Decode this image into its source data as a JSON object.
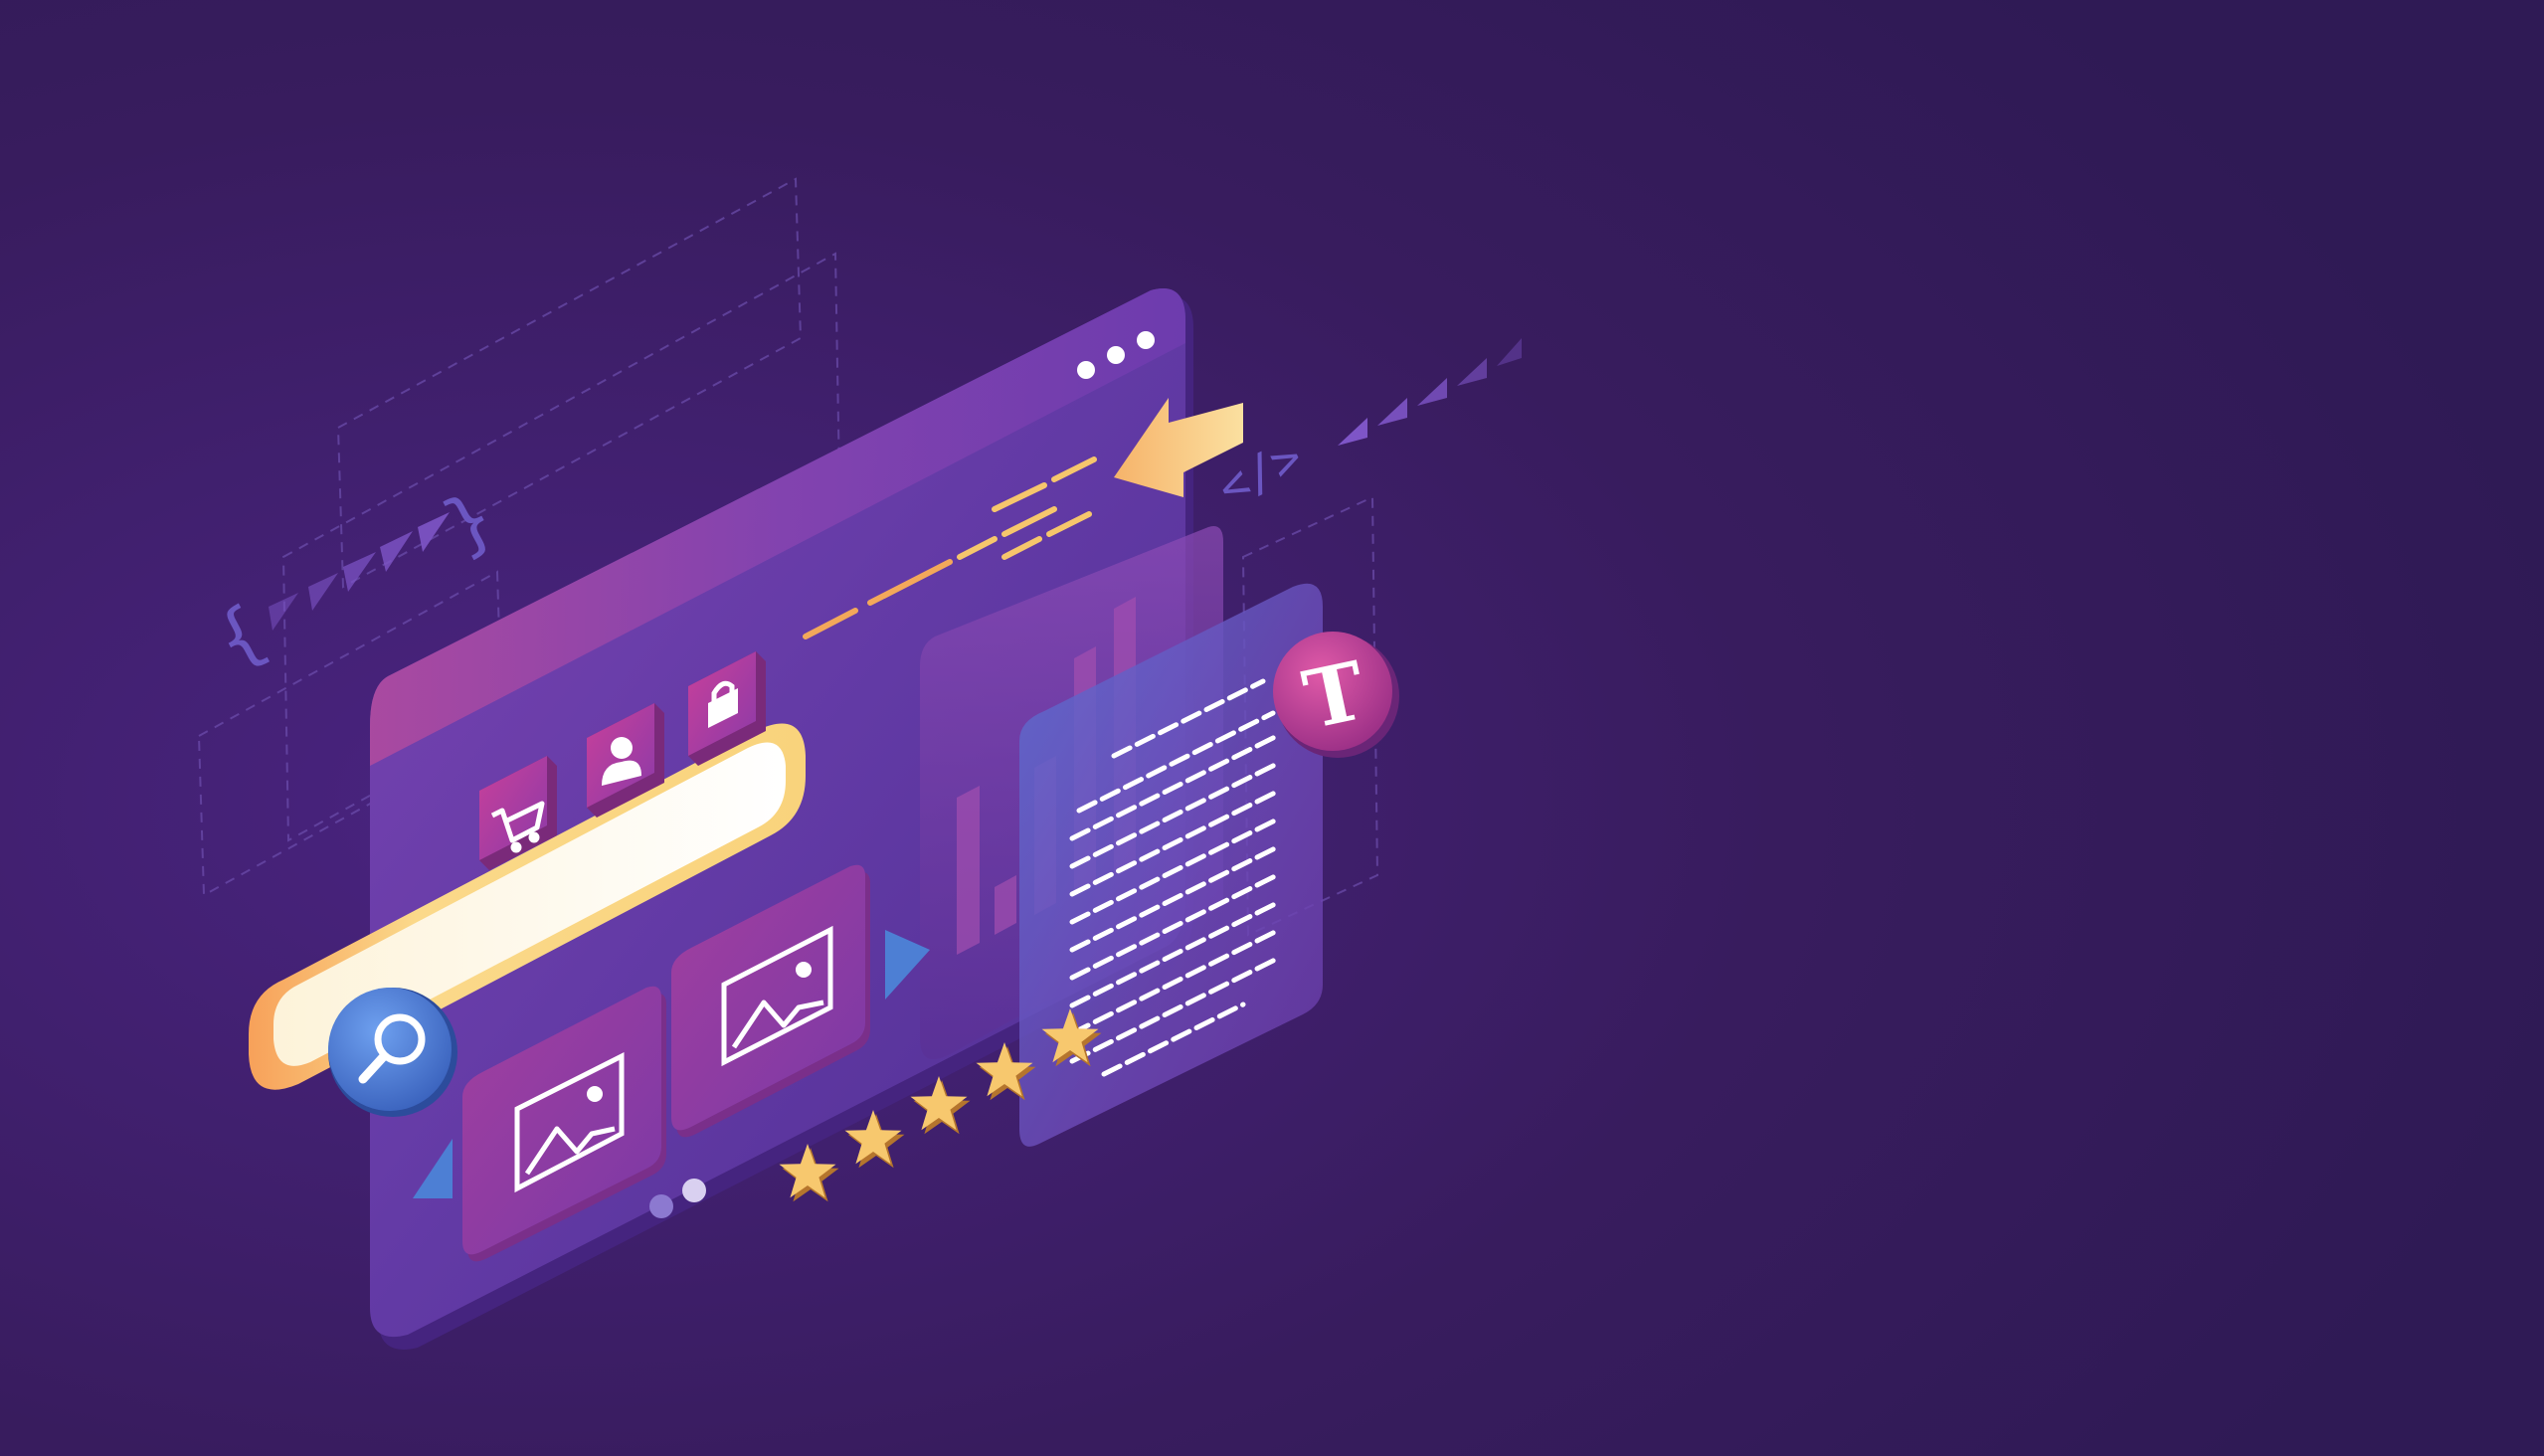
{
  "illustration": {
    "code_symbols": {
      "left_brace": "{",
      "right_brace": "}",
      "close_tag": "</>",
      "type_letter": "T"
    },
    "rating": {
      "stars": 5,
      "max": 5
    },
    "icons": [
      "cart-icon",
      "user-icon",
      "lock-icon",
      "search-icon",
      "image-icon",
      "image-icon",
      "text-type-icon",
      "arrow-icon",
      "star-icon",
      "menu-dots-icon"
    ],
    "colors": {
      "background": "#371b5c",
      "panel": "#6a3aa6",
      "panel_edge": "#4a2584",
      "accent_pink": "#c5358f",
      "accent_gold": "#f7c86e",
      "accent_blue": "#4d7fd4",
      "dashed_line": "#7a5cc0"
    }
  }
}
